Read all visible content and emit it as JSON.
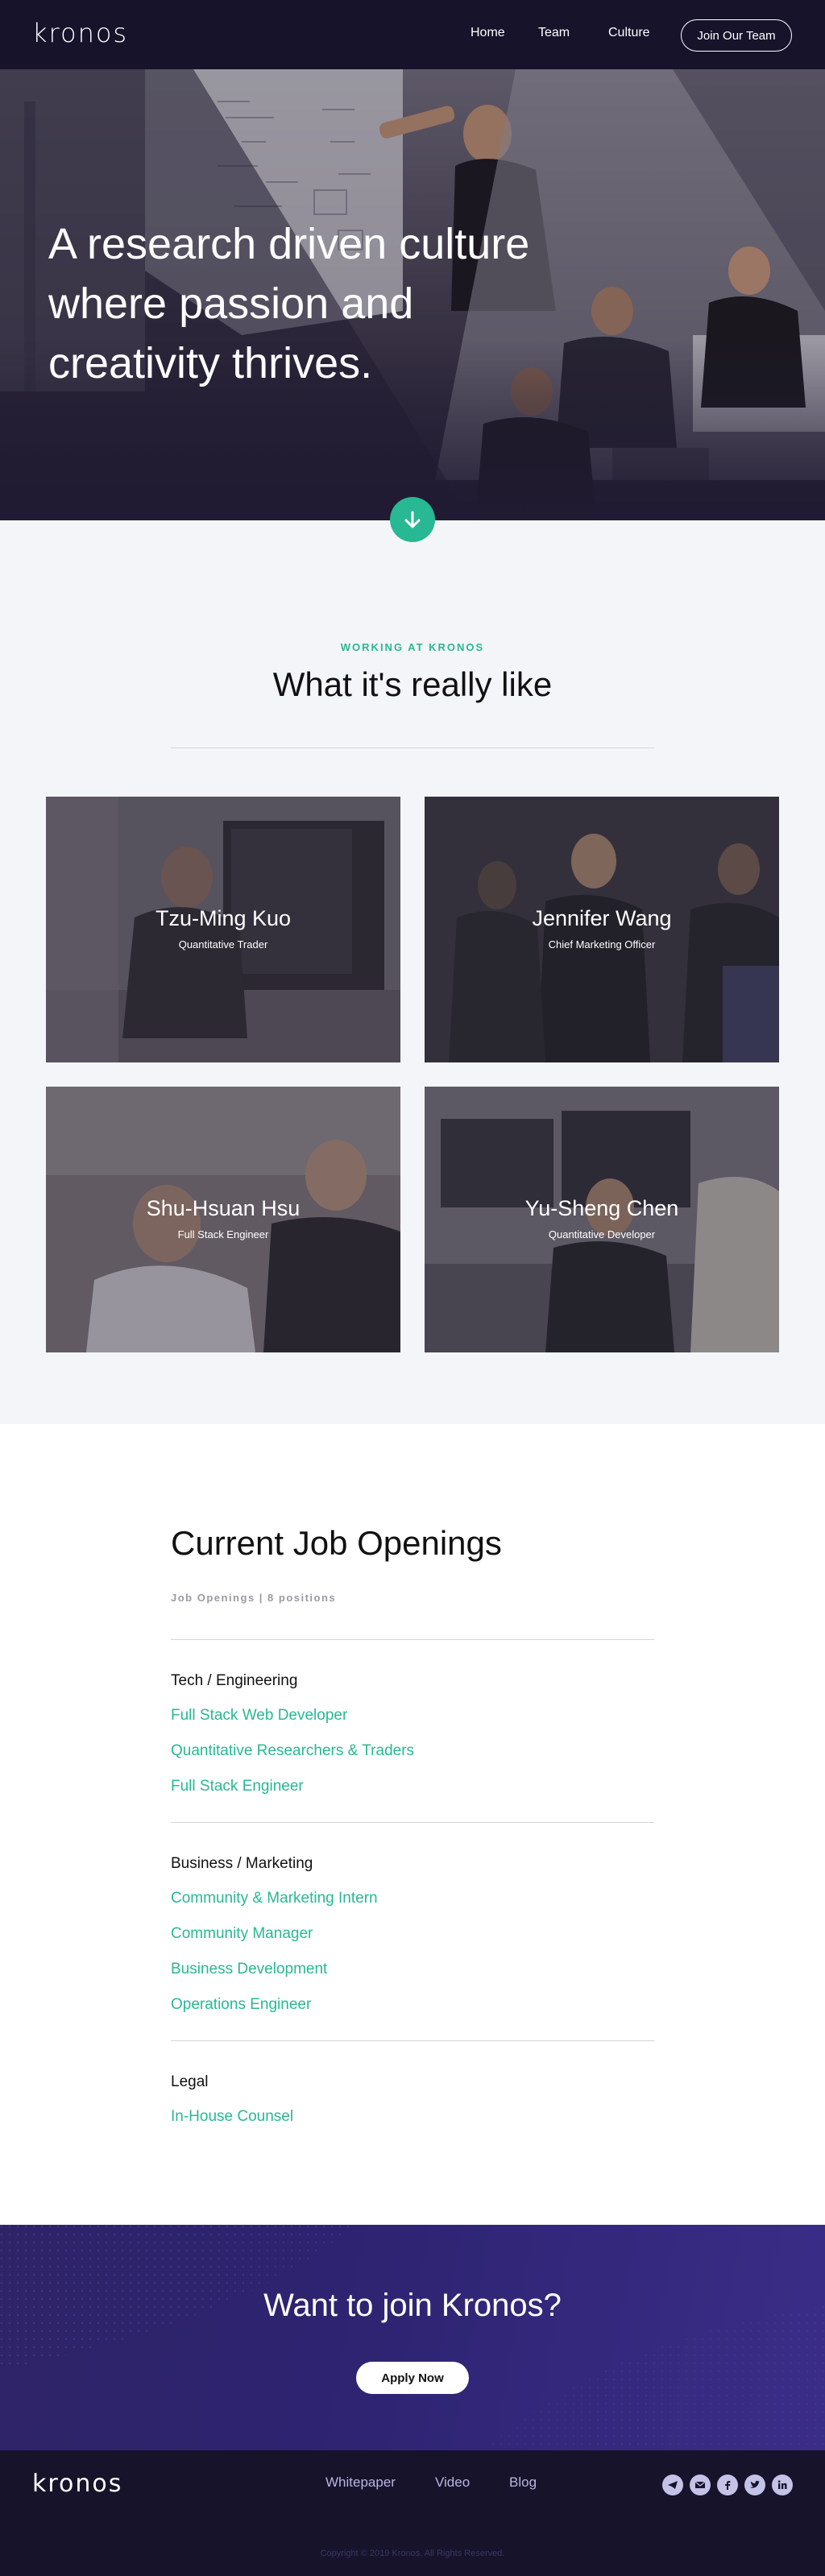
{
  "nav": {
    "logo": "kronos",
    "links": [
      "Home",
      "Team",
      "Culture"
    ],
    "cta": "Join Our Team"
  },
  "hero": {
    "title": "A research driven culture where passion and creativity thrives."
  },
  "working": {
    "eyebrow": "WORKING AT KRONOS",
    "title": "What it's really like",
    "people": [
      {
        "name": "Tzu-Ming Kuo",
        "role": "Quantitative Trader"
      },
      {
        "name": "Jennifer Wang",
        "role": "Chief Marketing Officer"
      },
      {
        "name": "Shu-Hsuan Hsu",
        "role": "Full Stack Engineer"
      },
      {
        "name": "Yu-Sheng Chen",
        "role": "Quantitative Developer"
      }
    ]
  },
  "jobs": {
    "title": "Current Job Openings",
    "meta": "Job Openings | 8 positions",
    "categories": [
      {
        "name": "Tech / Engineering",
        "jobs": [
          "Full Stack Web Developer",
          "Quantitative Researchers & Traders",
          "Full Stack Engineer"
        ]
      },
      {
        "name": "Business / Marketing",
        "jobs": [
          "Community & Marketing Intern",
          "Community Manager",
          "Business Development",
          "Operations Engineer"
        ]
      },
      {
        "name": "Legal",
        "jobs": [
          "In-House Counsel"
        ]
      }
    ]
  },
  "cta": {
    "title": "Want to join Kronos?",
    "button": "Apply Now"
  },
  "footer": {
    "logo": "kronos",
    "links": [
      "Whitepaper",
      "Video",
      "Blog"
    ],
    "social": [
      "telegram-icon",
      "email-icon",
      "facebook-icon",
      "twitter-icon",
      "linkedin-icon"
    ],
    "copyright": "Copyright © 2019 Kronos. All Rights Reserved."
  },
  "colors": {
    "accent": "#28b893",
    "nav_bg": "#16132b",
    "cta_bg": "#2d2370"
  }
}
